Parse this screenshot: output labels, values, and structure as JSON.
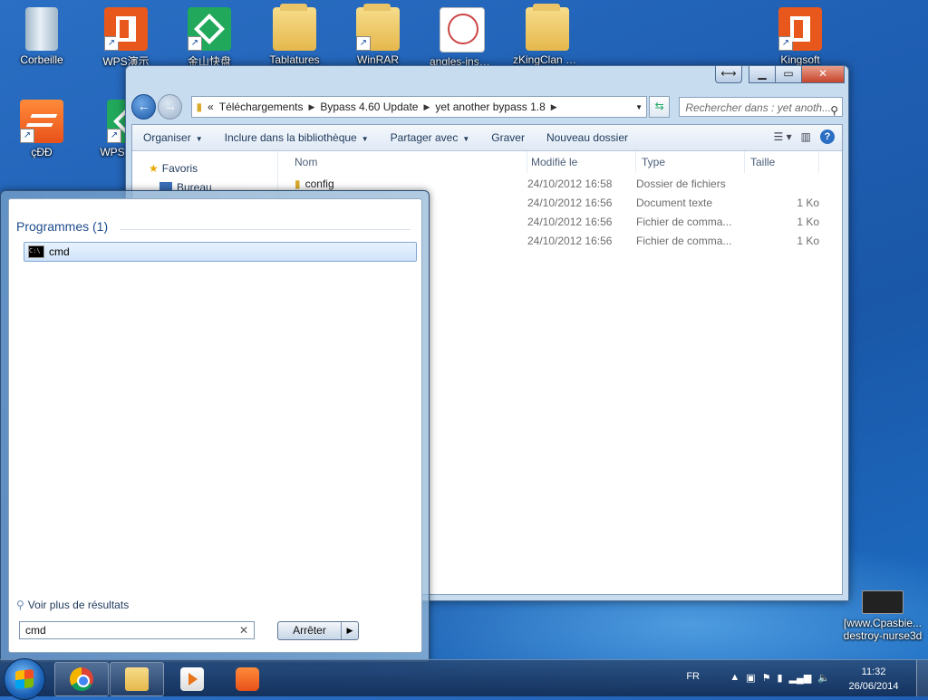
{
  "desktop": {
    "icons": [
      {
        "label": "Corbeille"
      },
      {
        "label": "WPS演示"
      },
      {
        "label": "金山快盘"
      },
      {
        "label": "Tablatures"
      },
      {
        "label": "WinRAR"
      },
      {
        "label": "angles-inscrits..."
      },
      {
        "label": "zKingClan Free"
      },
      {
        "label": "Kingsoft"
      },
      {
        "label": "çĐĐ"
      },
      {
        "label": "WPS"
      },
      {
        "label": "[www.Cpasbie..."
      },
      {
        "label": "destroy-nurse3d"
      }
    ]
  },
  "explorer": {
    "address": {
      "prefix": "«",
      "crumbs": [
        "Téléchargements",
        "Bypass 4.60 Update",
        "yet another bypass 1.8"
      ]
    },
    "search_placeholder": "Rechercher dans : yet anoth...",
    "toolbar": {
      "organize": "Organiser",
      "include": "Inclure dans la bibliothèque",
      "share": "Partager avec",
      "burn": "Graver",
      "new_folder": "Nouveau dossier"
    },
    "nav": {
      "favorites": "Favoris",
      "desktop": "Bureau"
    },
    "columns": {
      "name": "Nom",
      "modified": "Modifié le",
      "type": "Type",
      "size": "Taille"
    },
    "rows": [
      {
        "name": "config",
        "date": "24/10/2012 16:58",
        "type": "Dossier de fichiers",
        "size": ""
      },
      {
        "name": "",
        "date": "24/10/2012 16:56",
        "type": "Document texte",
        "size": "1 Ko"
      },
      {
        "name": "",
        "date": "24/10/2012 16:56",
        "type": "Fichier de comma...",
        "size": "1 Ko"
      },
      {
        "name": "",
        "date": "24/10/2012 16:56",
        "type": "Fichier de comma...",
        "size": "1 Ko"
      }
    ]
  },
  "start_menu": {
    "programs_header": "Programmes (1)",
    "result": "cmd",
    "more_results": "Voir plus de résultats",
    "search_value": "cmd",
    "shutdown_label": "Arrêter"
  },
  "taskbar": {
    "language": "FR",
    "time": "11:32",
    "date": "26/06/2014"
  }
}
